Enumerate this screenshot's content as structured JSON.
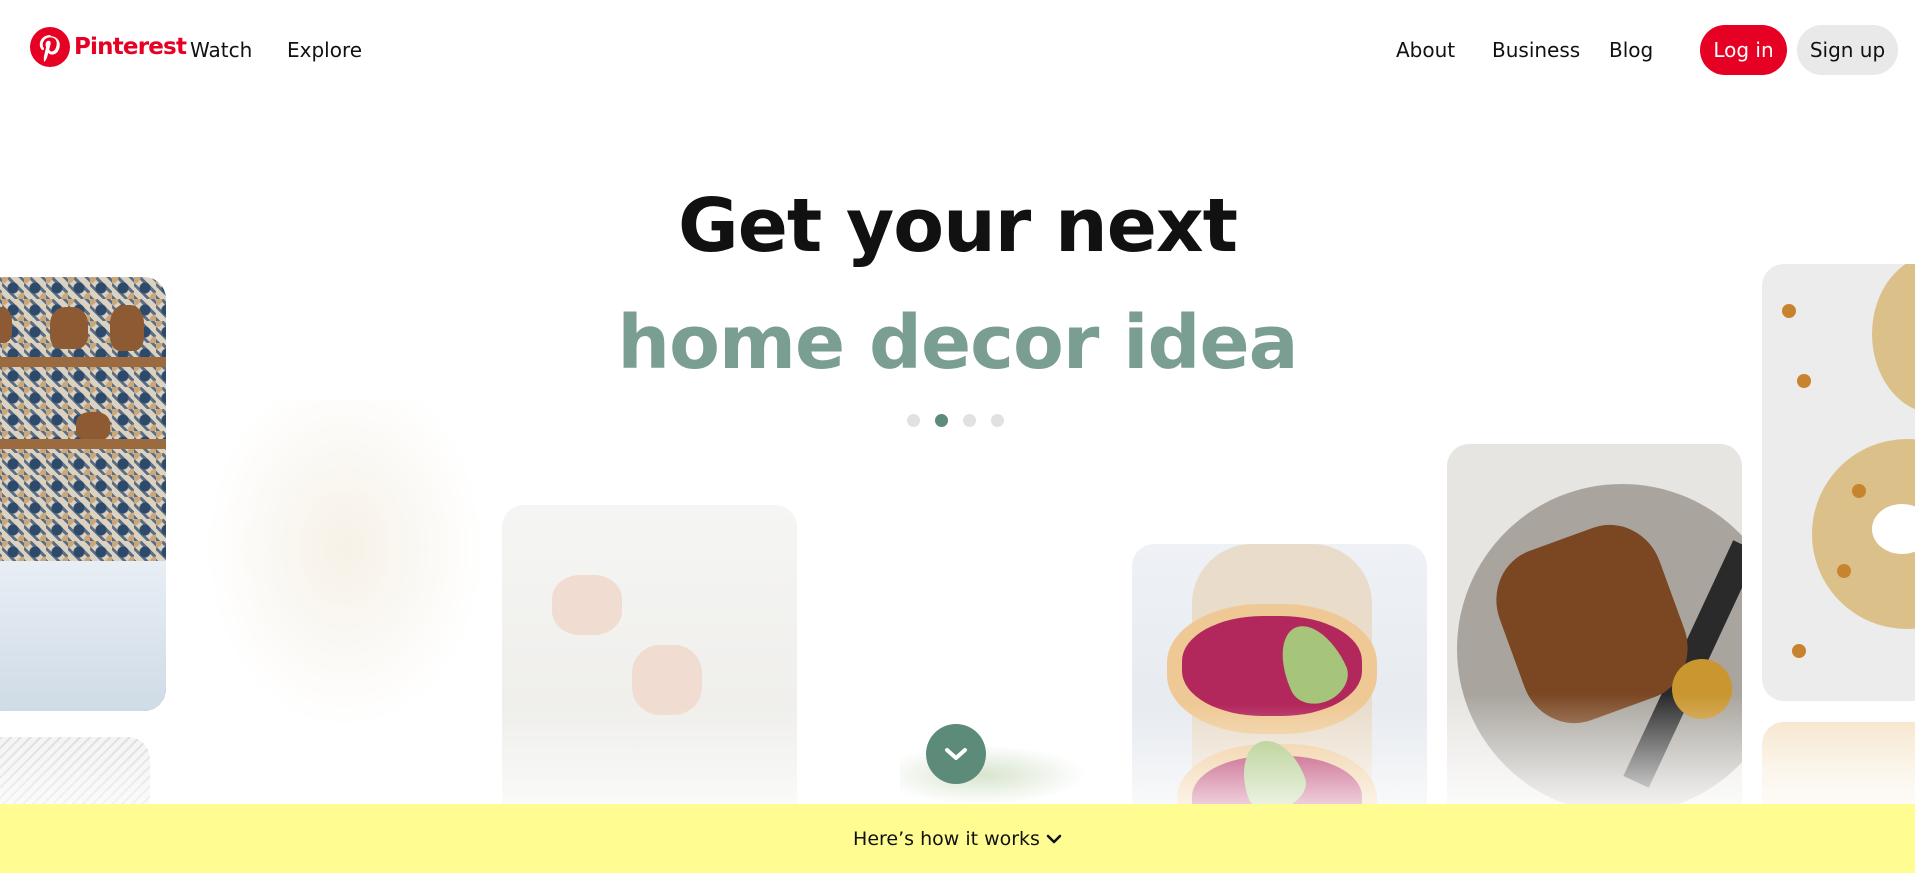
{
  "brand": {
    "name": "Pinterest",
    "color": "#e60023"
  },
  "nav": {
    "left": [
      "Watch",
      "Explore"
    ],
    "right": [
      "About",
      "Business",
      "Blog"
    ],
    "login_label": "Log in",
    "signup_label": "Sign up"
  },
  "hero": {
    "headline": "Get your next",
    "subline": "home decor idea",
    "subline_color": "#7a9e92",
    "carousel_dots": 4,
    "active_dot": 2
  },
  "scroll_button": {
    "icon": "chevron-down-icon",
    "color": "#5c8b79"
  },
  "footer_bar": {
    "label": "Here’s how it works",
    "icon": "chevron-down-icon",
    "color": "#fffd92"
  }
}
